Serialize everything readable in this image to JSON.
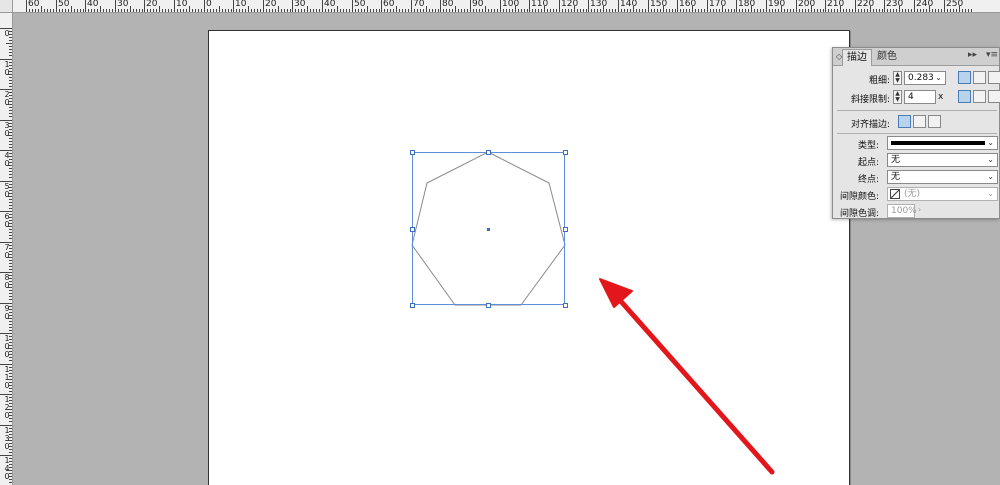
{
  "ruler": {
    "top_labels": [
      "60",
      "50",
      "40",
      "30",
      "20",
      "10",
      "0",
      "10",
      "20",
      "30",
      "40",
      "50",
      "60",
      "70",
      "80",
      "90",
      "100",
      "110",
      "120",
      "130",
      "140",
      "150",
      "160",
      "170",
      "180",
      "190",
      "200",
      "210",
      "220",
      "230",
      "240",
      "250"
    ],
    "left_labels": [
      "0",
      "1 0",
      "2 0",
      "3 0",
      "4 0",
      "5 0",
      "6 0",
      "7 0",
      "8 0",
      "9 0",
      "1 0 0",
      "1 1 0",
      "1 2 0",
      "1 3 0",
      "1 4 0"
    ]
  },
  "panel": {
    "tab_stroke": "描边",
    "tab_color": "颜色",
    "weight_label": "粗细:",
    "weight_value": "0.283",
    "miter_label": "斜接限制:",
    "miter_value": "4",
    "miter_unit": "x",
    "align_label": "对齐描边:",
    "type_label": "类型:",
    "start_label": "起点:",
    "start_value": "无",
    "end_label": "终点:",
    "end_value": "无",
    "gap_color_label": "间隙颜色:",
    "gap_color_value": "(无)",
    "gap_tint_label": "间隙色调:",
    "gap_tint_value": "100%"
  },
  "colors": {
    "selection": "#5e8fd6",
    "arrow": "#e3171b",
    "shape_stroke": "#8a8a8a"
  }
}
